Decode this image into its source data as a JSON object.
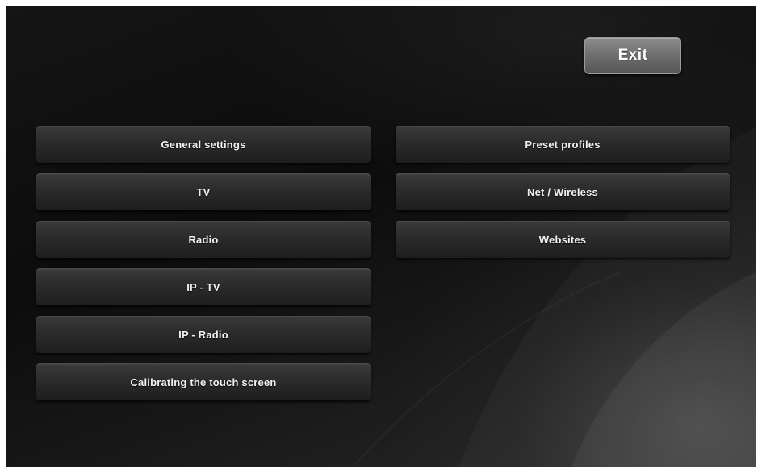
{
  "header": {
    "exit_label": "Exit"
  },
  "menu": {
    "left": [
      {
        "label": "General settings"
      },
      {
        "label": "TV"
      },
      {
        "label": "Radio"
      },
      {
        "label": "IP - TV"
      },
      {
        "label": "IP - Radio"
      },
      {
        "label": "Calibrating the touch screen"
      }
    ],
    "right": [
      {
        "label": "Preset profiles"
      },
      {
        "label": "Net / Wireless"
      },
      {
        "label": "Websites"
      }
    ]
  },
  "colors": {
    "background": "#0c0c0c",
    "button": "#2b2b2b",
    "exit_button": "#6e6e6e",
    "text": "#f2f2f2"
  }
}
